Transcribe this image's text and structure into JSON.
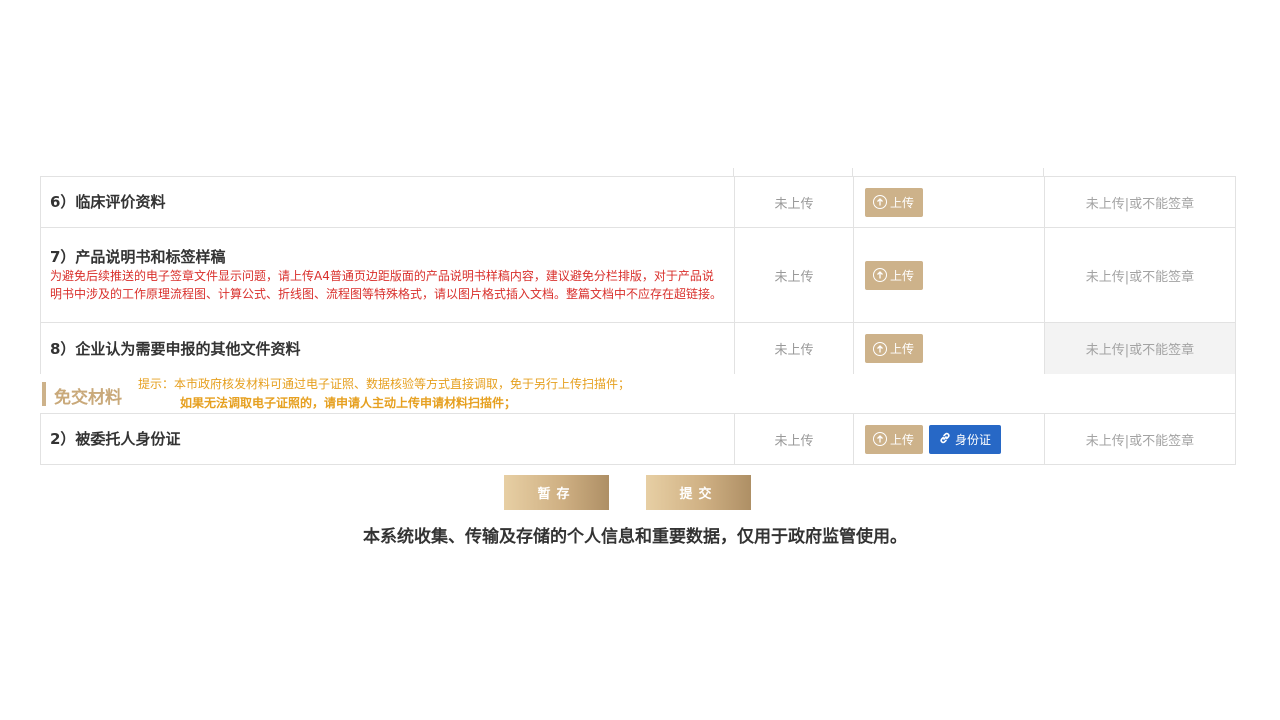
{
  "rows": [
    {
      "title": "6）临床评价资料",
      "note": "",
      "status": "未上传",
      "upload_label": "上传",
      "sign": "未上传|或不能签章"
    },
    {
      "title": "7）产品说明书和标签样稿",
      "note": "为避免后续推送的电子签章文件显示问题，请上传A4普通页边距版面的产品说明书样稿内容，建议避免分栏排版，对于产品说明书中涉及的工作原理流程图、计算公式、折线图、流程图等特殊格式，请以图片格式插入文档。整篇文档中不应存在超链接。",
      "status": "未上传",
      "upload_label": "上传",
      "sign": "未上传|或不能签章"
    },
    {
      "title": "8）企业认为需要申报的其他文件资料",
      "note": "",
      "status": "未上传",
      "upload_label": "上传",
      "sign": "未上传|或不能签章"
    }
  ],
  "exempt": {
    "label": "免交材料",
    "tip_line1": "提示：本市政府核发材料可通过电子证照、数据核验等方式直接调取，免于另行上传扫描件；",
    "tip_line2": "如果无法调取电子证照的，请申请人主动上传申请材料扫描件；"
  },
  "exempt_rows": [
    {
      "title": "2）被委托人身份证",
      "status": "未上传",
      "upload_label": "上传",
      "id_label": "身份证",
      "sign": "未上传|或不能签章"
    }
  ],
  "buttons": {
    "save": "暂存",
    "submit": "提交"
  },
  "footer": "本系统收集、传输及存储的个人信息和重要数据，仅用于政府监管使用。",
  "colors": {
    "gold": "#cdb28a",
    "blue": "#2768c6",
    "warning": "#e6a020",
    "note_red": "#d9302c"
  }
}
